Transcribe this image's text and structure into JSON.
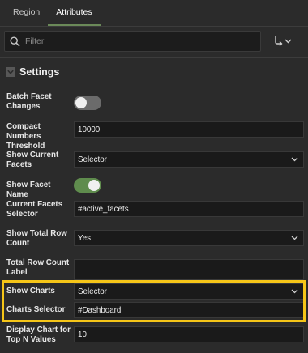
{
  "tabs": [
    {
      "label": "Region",
      "active": false
    },
    {
      "label": "Attributes",
      "active": true
    }
  ],
  "search": {
    "placeholder": "Filter",
    "icon": "search-icon"
  },
  "goto_icon": "goto-arrow-icon",
  "section": {
    "title": "Settings",
    "collapsed": false
  },
  "settings": {
    "batch_facet_changes": {
      "label": "Batch Facet Changes",
      "toggle": false
    },
    "compact_numbers_threshold": {
      "label": "Compact Numbers Threshold",
      "value": "10000"
    },
    "show_current_facets": {
      "label": "Show Current Facets",
      "value": "Selector"
    },
    "show_facet_name": {
      "label": "Show Facet Name",
      "toggle": true
    },
    "current_facets_selector": {
      "label": "Current Facets Selector",
      "value": "#active_facets"
    },
    "show_total_row_count": {
      "label": "Show Total Row Count",
      "value": "Yes"
    },
    "total_row_count_label": {
      "label": "Total Row Count Label",
      "value": ""
    },
    "show_charts": {
      "label": "Show Charts",
      "value": "Selector"
    },
    "charts_selector": {
      "label": "Charts Selector",
      "value": "#Dashboard"
    },
    "display_chart_top_n": {
      "label": "Display Chart for Top N Values",
      "value": "10"
    }
  },
  "colors": {
    "background": "#2b2b2b",
    "field_bg": "#1a1a1a",
    "toggle_on": "#5f8c4d",
    "toggle_off": "#6b6b6b",
    "highlight": "#f5c518",
    "active_tab_underline": "#6b8a59"
  }
}
